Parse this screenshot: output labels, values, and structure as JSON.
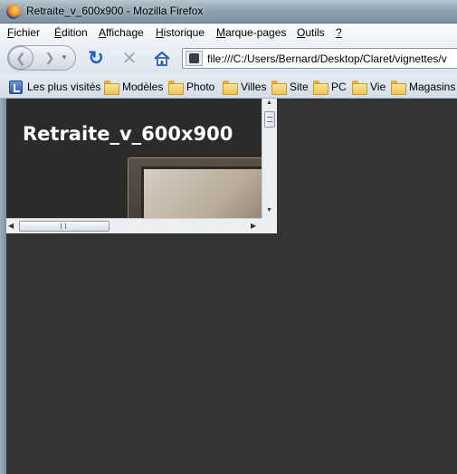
{
  "window": {
    "title": "Retraite_v_600x900 - Mozilla Firefox"
  },
  "menu": {
    "items": [
      {
        "mnemonic": "F",
        "rest": "ichier"
      },
      {
        "mnemonic": "É",
        "rest": "dition"
      },
      {
        "mnemonic": "A",
        "rest": "ffichage"
      },
      {
        "mnemonic": "H",
        "rest": "istorique"
      },
      {
        "mnemonic": "M",
        "rest": "arque-pages"
      },
      {
        "mnemonic": "O",
        "rest": "utils"
      },
      {
        "mnemonic": "?",
        "rest": ""
      }
    ]
  },
  "nav": {
    "back_icon": "back-arrow-icon",
    "forward_icon": "forward-arrow-icon",
    "reload_icon": "reload-icon",
    "stop_icon": "stop-icon",
    "home_icon": "home-icon",
    "url": "file:///C:/Users/Bernard/Desktop/Claret/vignettes/v"
  },
  "bookmarks": {
    "most_visited": "Les plus visités",
    "folders": [
      "Modèles",
      "Photo",
      "Villes",
      "Site",
      "PC",
      "Vie",
      "Magasins"
    ]
  },
  "page": {
    "heading": "Retraite_v_600x900",
    "background": "#2b2b2b",
    "outer_background": "#333333"
  },
  "colors": {
    "accent_reload": "#1f5fbf",
    "titlebar": "#8ea3b1"
  }
}
